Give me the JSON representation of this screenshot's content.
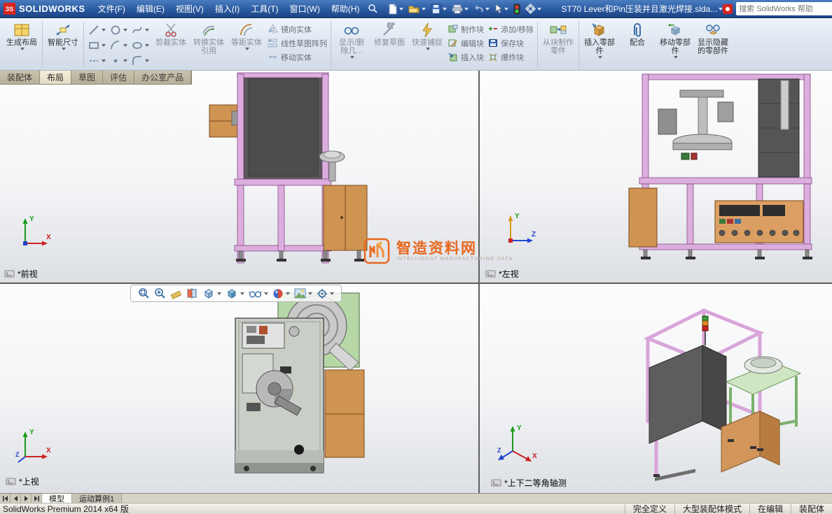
{
  "title_bar": {
    "logo_badge": "ЗS",
    "logo_text": "SOLIDWORKS",
    "doc_title": "ST70 Lever和Pin压装并且激光焊接.slda...",
    "search_placeholder": "搜索 SolidWorks 帮助"
  },
  "menu": {
    "items": [
      "文件(F)",
      "编辑(E)",
      "视图(V)",
      "插入(I)",
      "工具(T)",
      "窗口(W)",
      "帮助(H)"
    ]
  },
  "ribbon": {
    "buttons": {
      "create_layout": "生成布局",
      "smart_dimension": "智能尺寸",
      "trim_entities": "剪裁实体",
      "convert_entities": "转换实体引用",
      "offset_entities": "等距实体",
      "mirror_entities": "镜向实体",
      "linear_sketch_pattern": "线性草图阵列",
      "move_entities": "移动实体",
      "display_delete_relations": "显示/删除几...",
      "repair_sketch": "修复草图",
      "quick_snaps": "快速捕捉",
      "make_block": "制作块",
      "edit_block": "编辑块",
      "insert_block": "插入块",
      "add_remove": "添加/移除",
      "save_block": "保存块",
      "explode_block": "爆炸块",
      "make_part_from_block": "从块制作零件",
      "insert_components": "插入零部件",
      "mate": "配合",
      "move_component": "移动零部件",
      "show_hidden_components": "显示隐藏的零部件"
    }
  },
  "command_tabs": {
    "items": [
      "装配体",
      "布局",
      "草图",
      "评估",
      "办公室产品"
    ],
    "active": "布局"
  },
  "viewports": {
    "front": {
      "label": "*前视"
    },
    "left": {
      "label": "*左视"
    },
    "top": {
      "label": "*上视"
    },
    "isometric": {
      "label": "*上下二等角轴测"
    }
  },
  "axes": {
    "x": "X",
    "y": "Y",
    "z": "Z"
  },
  "watermark": {
    "title": "智造资料网",
    "subtitle": "INTELLIGENT MANUFACTURING DATA"
  },
  "bottom_tabs": {
    "items": [
      "模型",
      "运动算例1"
    ],
    "active": "模型"
  },
  "status_bar": {
    "left": "SolidWorks Premium 2014 x64 版",
    "items": [
      "完全定义",
      "大型装配体模式",
      "在编辑",
      "装配体"
    ]
  }
}
